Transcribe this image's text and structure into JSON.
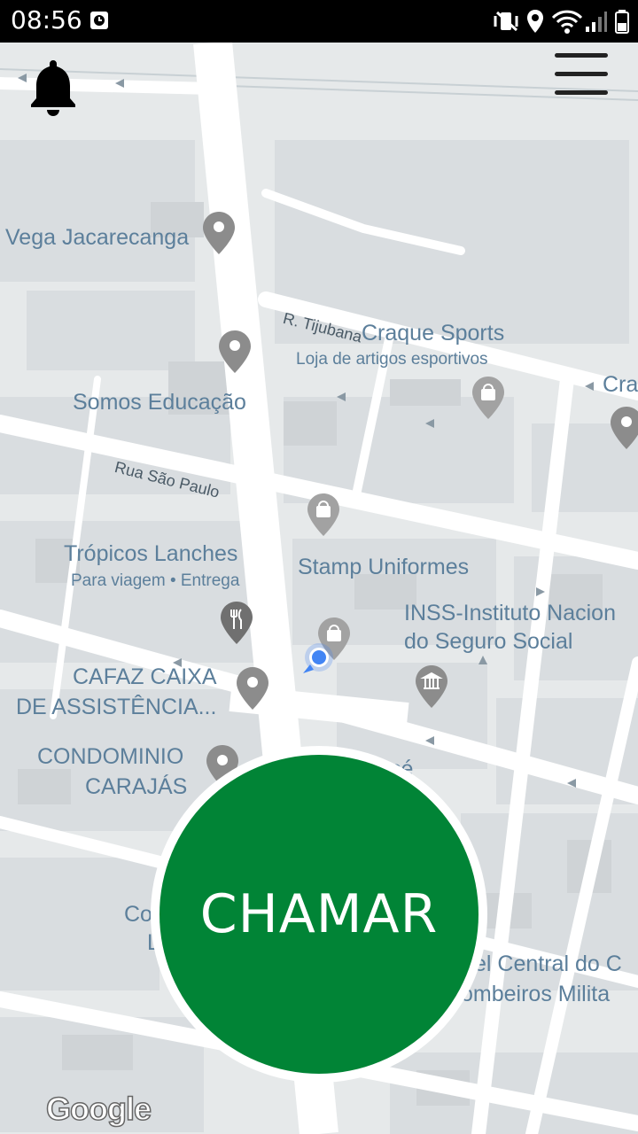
{
  "status": {
    "time": "08:56"
  },
  "map": {
    "labels": {
      "vega": "Vega Jacarecanga",
      "tijubana": "R. Tijubana",
      "craque": "Craque Sports",
      "craque_sub": "Loja de artigos esportivos",
      "cra": "Cra",
      "somos": "Somos Educação",
      "rua_sao_paulo": "Rua São Paulo",
      "tropicos": "Trópicos Lanches",
      "tropicos_sub": "Para viagem • Entrega",
      "stamp": "Stamp Uniformes",
      "inss1": "INSS-Instituto Nacion",
      "inss2": "do Seguro Social",
      "cafaz1": "CAFAZ CAIXA",
      "cafaz2": "DE ASSISTÊNCIA...",
      "condo1": "CONDOMINIO",
      "condo2": "CARAJÁS",
      "frag_co": "Co",
      "frag_l": "L",
      "frag_ce": "cé",
      "quartel1": "el Central do C",
      "quartel2": "ombeiros Milita"
    },
    "attribution": "Google"
  },
  "action": {
    "call_label": "CHAMAR"
  },
  "colors": {
    "accent": "#018436",
    "map_label": "#5c7f9b",
    "location_dot": "#4285f4"
  }
}
